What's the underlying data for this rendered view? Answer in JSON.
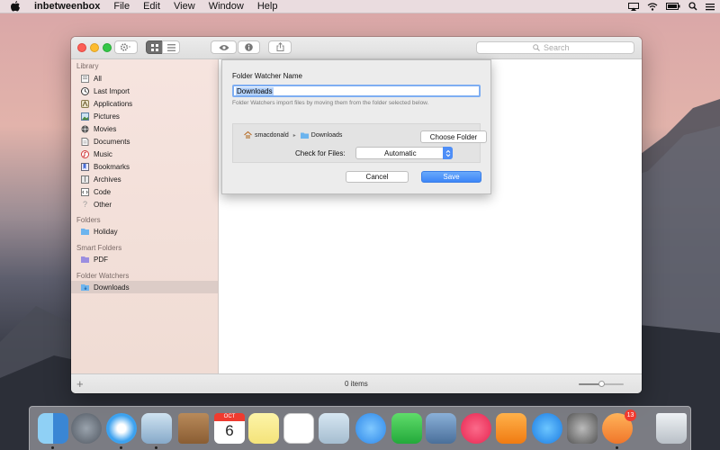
{
  "menubar": {
    "app_name": "inbetweenbox",
    "items": [
      "File",
      "Edit",
      "View",
      "Window",
      "Help"
    ]
  },
  "toolbar": {
    "search_placeholder": "Search"
  },
  "sidebar": {
    "library_heading": "Library",
    "library_items": [
      {
        "label": "All",
        "icon": "all-icon"
      },
      {
        "label": "Last Import",
        "icon": "clock-icon"
      },
      {
        "label": "Applications",
        "icon": "applications-icon"
      },
      {
        "label": "Pictures",
        "icon": "pictures-icon"
      },
      {
        "label": "Movies",
        "icon": "movies-icon"
      },
      {
        "label": "Documents",
        "icon": "documents-icon"
      },
      {
        "label": "Music",
        "icon": "music-icon"
      },
      {
        "label": "Bookmarks",
        "icon": "bookmarks-icon"
      },
      {
        "label": "Archives",
        "icon": "archives-icon"
      },
      {
        "label": "Code",
        "icon": "code-icon"
      },
      {
        "label": "Other",
        "icon": "question-icon"
      }
    ],
    "folders_heading": "Folders",
    "folders_items": [
      {
        "label": "Holiday",
        "icon": "folder-icon"
      }
    ],
    "smart_heading": "Smart Folders",
    "smart_items": [
      {
        "label": "PDF",
        "icon": "smart-folder-icon"
      }
    ],
    "watchers_heading": "Folder Watchers",
    "watchers_items": [
      {
        "label": "Downloads",
        "icon": "downloads-folder-icon",
        "selected": true
      }
    ]
  },
  "statusbar": {
    "item_count": "0 items",
    "zoom_level": 0.5
  },
  "sheet": {
    "title": "Folder Watcher Name",
    "name_value": "Downloads",
    "help_text": "Folder Watchers import files by moving them from the folder selected below.",
    "path": [
      "smacdonald",
      "Downloads"
    ],
    "choose_folder_label": "Choose Folder",
    "check_label": "Check for Files:",
    "check_value": "Automatic",
    "cancel_label": "Cancel",
    "save_label": "Save"
  },
  "dock": {
    "calendar_month": "OCT",
    "calendar_day": "6",
    "badge_count": "13",
    "apps": [
      "finder-icon",
      "launchpad-icon",
      "safari-icon",
      "mail-icon",
      "contacts-icon",
      "calendar-icon",
      "notes-icon",
      "reminders-icon",
      "preview-icon",
      "messages-icon",
      "facetime-icon",
      "photo-icon",
      "itunes-icon",
      "ibooks-icon",
      "app-store-icon",
      "system-preferences-icon",
      "inbetweenbox-icon",
      "trash-icon"
    ]
  },
  "colors": {
    "accent": "#3d86f7",
    "sidebar_bg": "#f2dfd8",
    "selection": "#dcccc7"
  }
}
